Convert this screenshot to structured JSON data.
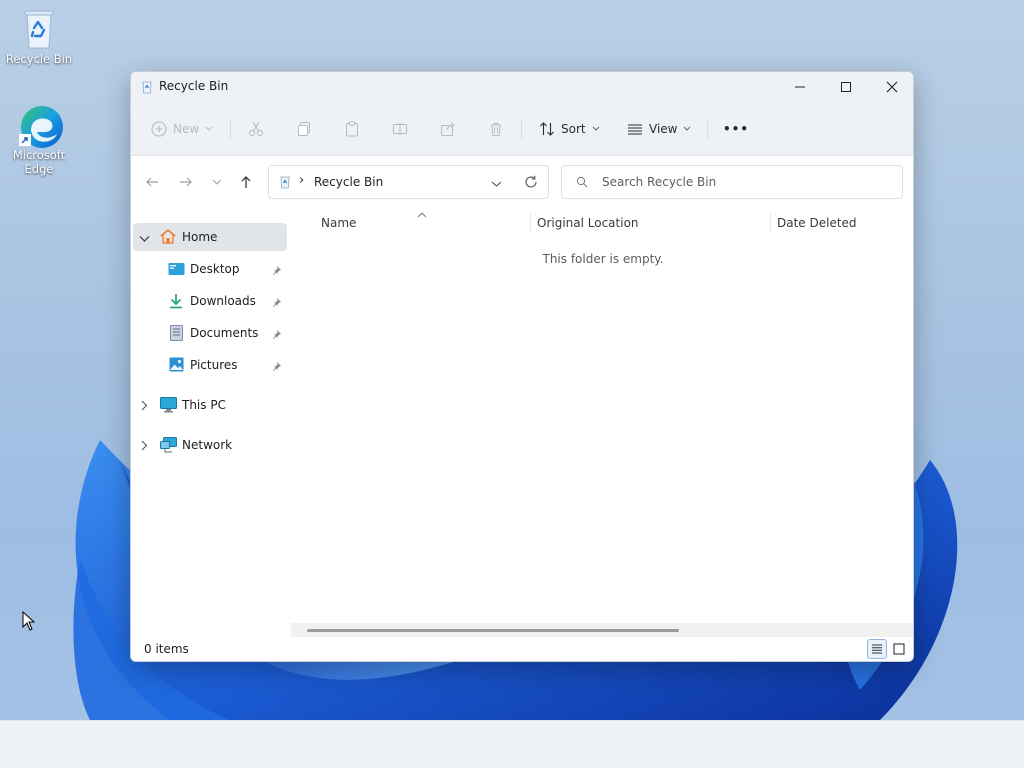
{
  "desktop": {
    "icons": [
      {
        "label": "Recycle Bin"
      },
      {
        "label_line1": "Microsoft",
        "label_line2": "Edge"
      }
    ]
  },
  "window": {
    "title": "Recycle Bin",
    "toolbar": {
      "new_label": "New",
      "sort_label": "Sort",
      "view_label": "View",
      "more_label": "•••"
    },
    "address": {
      "separator": "›",
      "location": "Recycle Bin"
    },
    "search": {
      "placeholder": "Search Recycle Bin"
    },
    "sidebar": {
      "home": "Home",
      "quick_access": [
        {
          "label": "Desktop",
          "icon": "desktop-folder-icon"
        },
        {
          "label": "Downloads",
          "icon": "download-arrow-icon"
        },
        {
          "label": "Documents",
          "icon": "document-icon"
        },
        {
          "label": "Pictures",
          "icon": "picture-icon"
        }
      ],
      "this_pc": "This PC",
      "network": "Network"
    },
    "columns": [
      "Name",
      "Original Location",
      "Date Deleted"
    ],
    "empty_message": "This folder is empty.",
    "status": "0 items"
  },
  "colors": {
    "accent": "#0a64c8",
    "selected_bg": "#e1e4e9",
    "chrome_bg": "#eef2f7"
  }
}
